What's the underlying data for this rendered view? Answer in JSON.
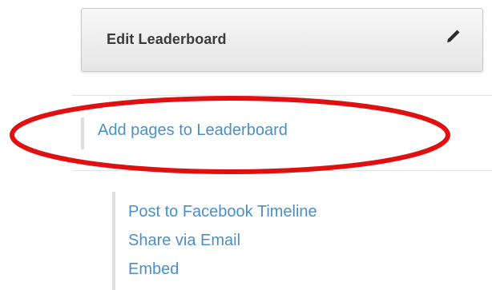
{
  "edit_panel": {
    "label": "Edit Leaderboard",
    "icon": "pencil-icon"
  },
  "add_pages": {
    "label": "Add pages to Leaderboard"
  },
  "highlight": {
    "color": "#e01010"
  },
  "share_links": [
    {
      "label": "Post to Facebook Timeline"
    },
    {
      "label": "Share via Email"
    },
    {
      "label": "Embed"
    }
  ],
  "colors": {
    "link": "#4a8fc8",
    "button_text": "#3a3a3a"
  }
}
